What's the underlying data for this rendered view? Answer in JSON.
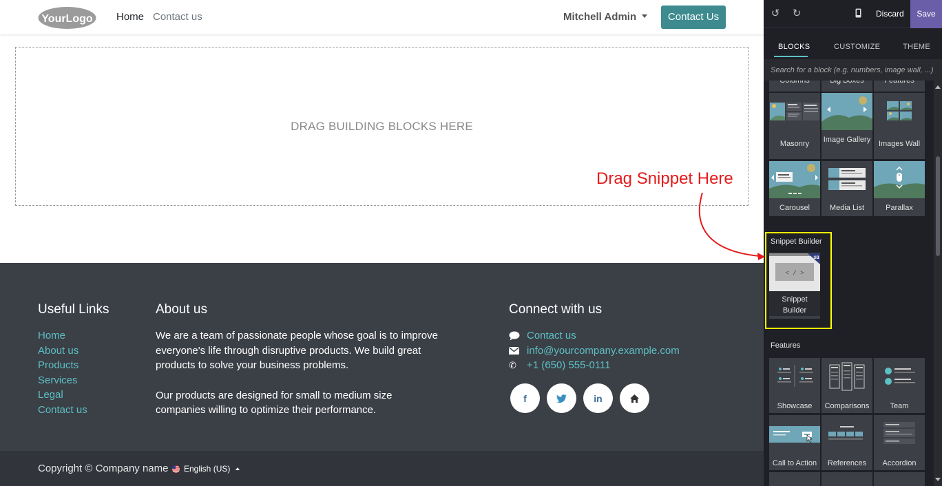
{
  "navbar": {
    "logo_text": "YourLogo",
    "links": [
      "Home",
      "Contact us"
    ],
    "user": "Mitchell Admin",
    "cta_label": "Contact Us"
  },
  "dropzone": {
    "label": "DRAG BUILDING BLOCKS HERE"
  },
  "annotation": {
    "text": "Drag Snippet Here",
    "color": "#e41b1b"
  },
  "footer": {
    "useful_links": {
      "title": "Useful Links",
      "items": [
        "Home",
        "About us",
        "Products",
        "Services",
        "Legal",
        "Contact us"
      ]
    },
    "about": {
      "title": "About us",
      "paragraphs": [
        "We are a team of passionate people whose goal is to improve everyone's life through disruptive products. We build great products to solve your business problems.",
        "Our products are designed for small to medium size companies willing to optimize their performance."
      ]
    },
    "connect": {
      "title": "Connect with us",
      "contact_label": "Contact us",
      "email": "info@yourcompany.example.com",
      "phone": "+1 (650) 555-0111",
      "socials": [
        "facebook-icon",
        "twitter-icon",
        "linkedin-icon",
        "home-icon"
      ]
    },
    "copyright": "Copyright © Company name",
    "language": "English (US)"
  },
  "editor": {
    "discard_label": "Discard",
    "save_label": "Save",
    "tabs": [
      "BLOCKS",
      "CUSTOMIZE",
      "THEME"
    ],
    "search_placeholder": "Search for a block (e.g. numbers, image wall, ...)",
    "partial_labels": [
      "Columns",
      "Big Boxes",
      "Features"
    ],
    "blocks_row1": [
      "Masonry",
      "Image Gallery",
      "Images Wall"
    ],
    "blocks_row2": [
      "Carousel",
      "Media List",
      "Parallax"
    ],
    "snippet_builder": {
      "category": "Snippet Builder",
      "label": "Snippet Builder",
      "badge": "SB",
      "code_text": "< / >"
    },
    "features": {
      "category": "Features",
      "row1": [
        "Showcase",
        "Comparisons",
        "Team"
      ],
      "row2": [
        "Call to Action",
        "References",
        "Accordion"
      ]
    },
    "colors": {
      "accent": "#5cc0c4",
      "save": "#6b5ea8",
      "highlight": "#ffff00"
    }
  }
}
